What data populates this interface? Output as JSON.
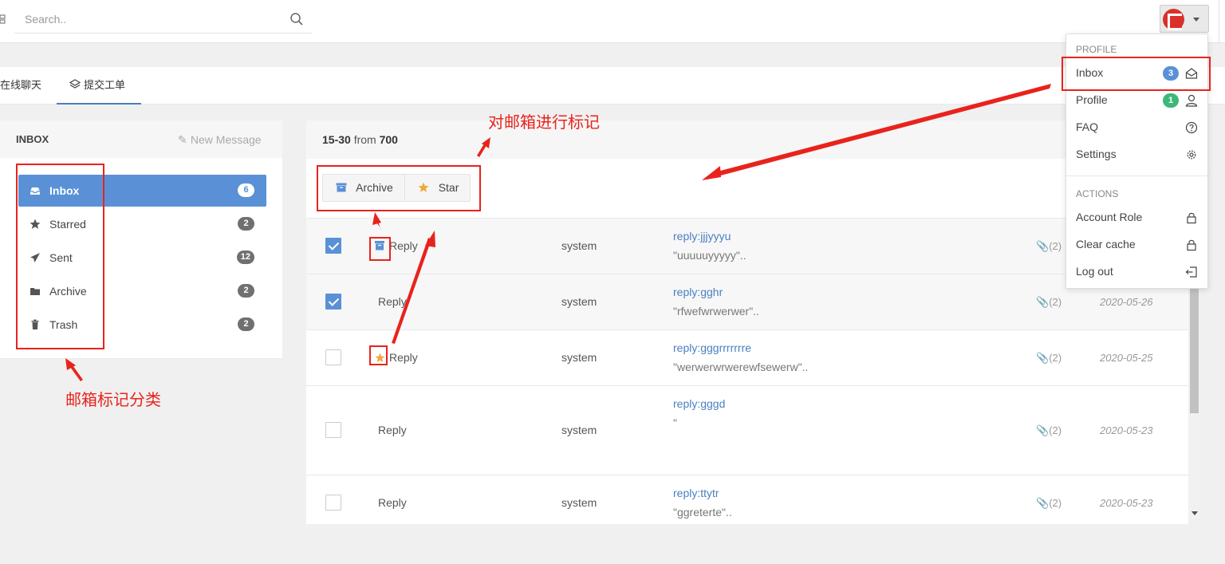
{
  "search": {
    "placeholder": "Search.."
  },
  "tabs": [
    {
      "label": "在线聊天"
    },
    {
      "label": "提交工单"
    }
  ],
  "inbox_panel": {
    "title": "INBOX",
    "new_message": "New Message",
    "items": [
      {
        "label": "Inbox",
        "count": "6",
        "icon": "inbox-icon",
        "active": true
      },
      {
        "label": "Starred",
        "count": "2",
        "icon": "star-icon"
      },
      {
        "label": "Sent",
        "count": "12",
        "icon": "paper-plane-icon"
      },
      {
        "label": "Archive",
        "count": "2",
        "icon": "folder-icon"
      },
      {
        "label": "Trash",
        "count": "2",
        "icon": "trash-icon"
      }
    ]
  },
  "messages": {
    "range": "15-30",
    "from_label": "from",
    "total": "700",
    "actions": {
      "archive": "Archive",
      "star": "Star"
    },
    "rows": [
      {
        "type": "Reply",
        "from": "system",
        "subject": "reply:jjjyyyu",
        "snippet": "\"uuuuuyyyyy\"..",
        "attachments": "(2)",
        "date": "",
        "checked": true,
        "flag": "archive"
      },
      {
        "type": "Reply",
        "from": "system",
        "subject": "reply:gghr",
        "snippet": "\"rfwefwrwerwer\"..",
        "attachments": "(2)",
        "date": "2020-05-26",
        "checked": true,
        "flag": ""
      },
      {
        "type": "Reply",
        "from": "system",
        "subject": "reply:gggrrrrrrre",
        "snippet": "\"werwerwrwerewfsewerw\"..",
        "attachments": "(2)",
        "date": "2020-05-25",
        "checked": false,
        "flag": "star"
      },
      {
        "type": "Reply",
        "from": "system",
        "subject": "reply:gggd",
        "snippet": "\"",
        "attachments": "(2)",
        "date": "2020-05-23",
        "checked": false,
        "flag": ""
      },
      {
        "type": "Reply",
        "from": "system",
        "subject": "reply:ttytr",
        "snippet": "\"ggreterte\"..",
        "attachments": "(2)",
        "date": "2020-05-23",
        "checked": false,
        "flag": ""
      }
    ]
  },
  "dropdown": {
    "profile_header": "PROFILE",
    "actions_header": "ACTIONS",
    "items": [
      {
        "label": "Inbox",
        "badge": "3",
        "badge_color": "#5a91d6",
        "icon": "envelope-open-icon"
      },
      {
        "label": "Profile",
        "badge": "1",
        "badge_color": "#3cb878",
        "icon": "user-icon"
      },
      {
        "label": "FAQ",
        "icon": "question-icon"
      },
      {
        "label": "Settings",
        "icon": "gear-icon"
      },
      {
        "label": "Account Role",
        "icon": "lock-icon"
      },
      {
        "label": "Clear cache",
        "icon": "lock-icon"
      },
      {
        "label": "Log out",
        "icon": "logout-icon"
      }
    ]
  },
  "annotations": {
    "mark_mailbox": "对邮箱进行标记",
    "mailbox_categories": "邮箱标记分类"
  },
  "colors": {
    "accent": "#5a91d6",
    "annotation": "#e8231c",
    "star": "#f0a93b",
    "success": "#3cb878"
  }
}
